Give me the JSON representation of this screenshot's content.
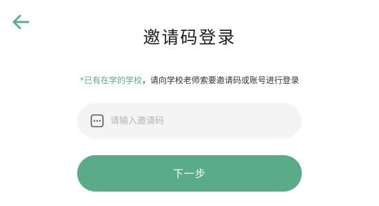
{
  "header": {
    "back_icon": "arrow-left-icon",
    "title": "邀请码登录"
  },
  "hint": {
    "accent_text": "*已有在学的学校",
    "rest_text": "，请向学校老师索要邀请码或账号进行登录"
  },
  "code_field": {
    "icon": "dots-box-icon",
    "value": "",
    "placeholder": "请输入邀请码"
  },
  "next_button": {
    "label": "下一步"
  },
  "colors": {
    "accent": "#5aab88",
    "field_background": "#f4f4f4",
    "placeholder": "#b4b4b4",
    "title": "#1e1e1e"
  }
}
